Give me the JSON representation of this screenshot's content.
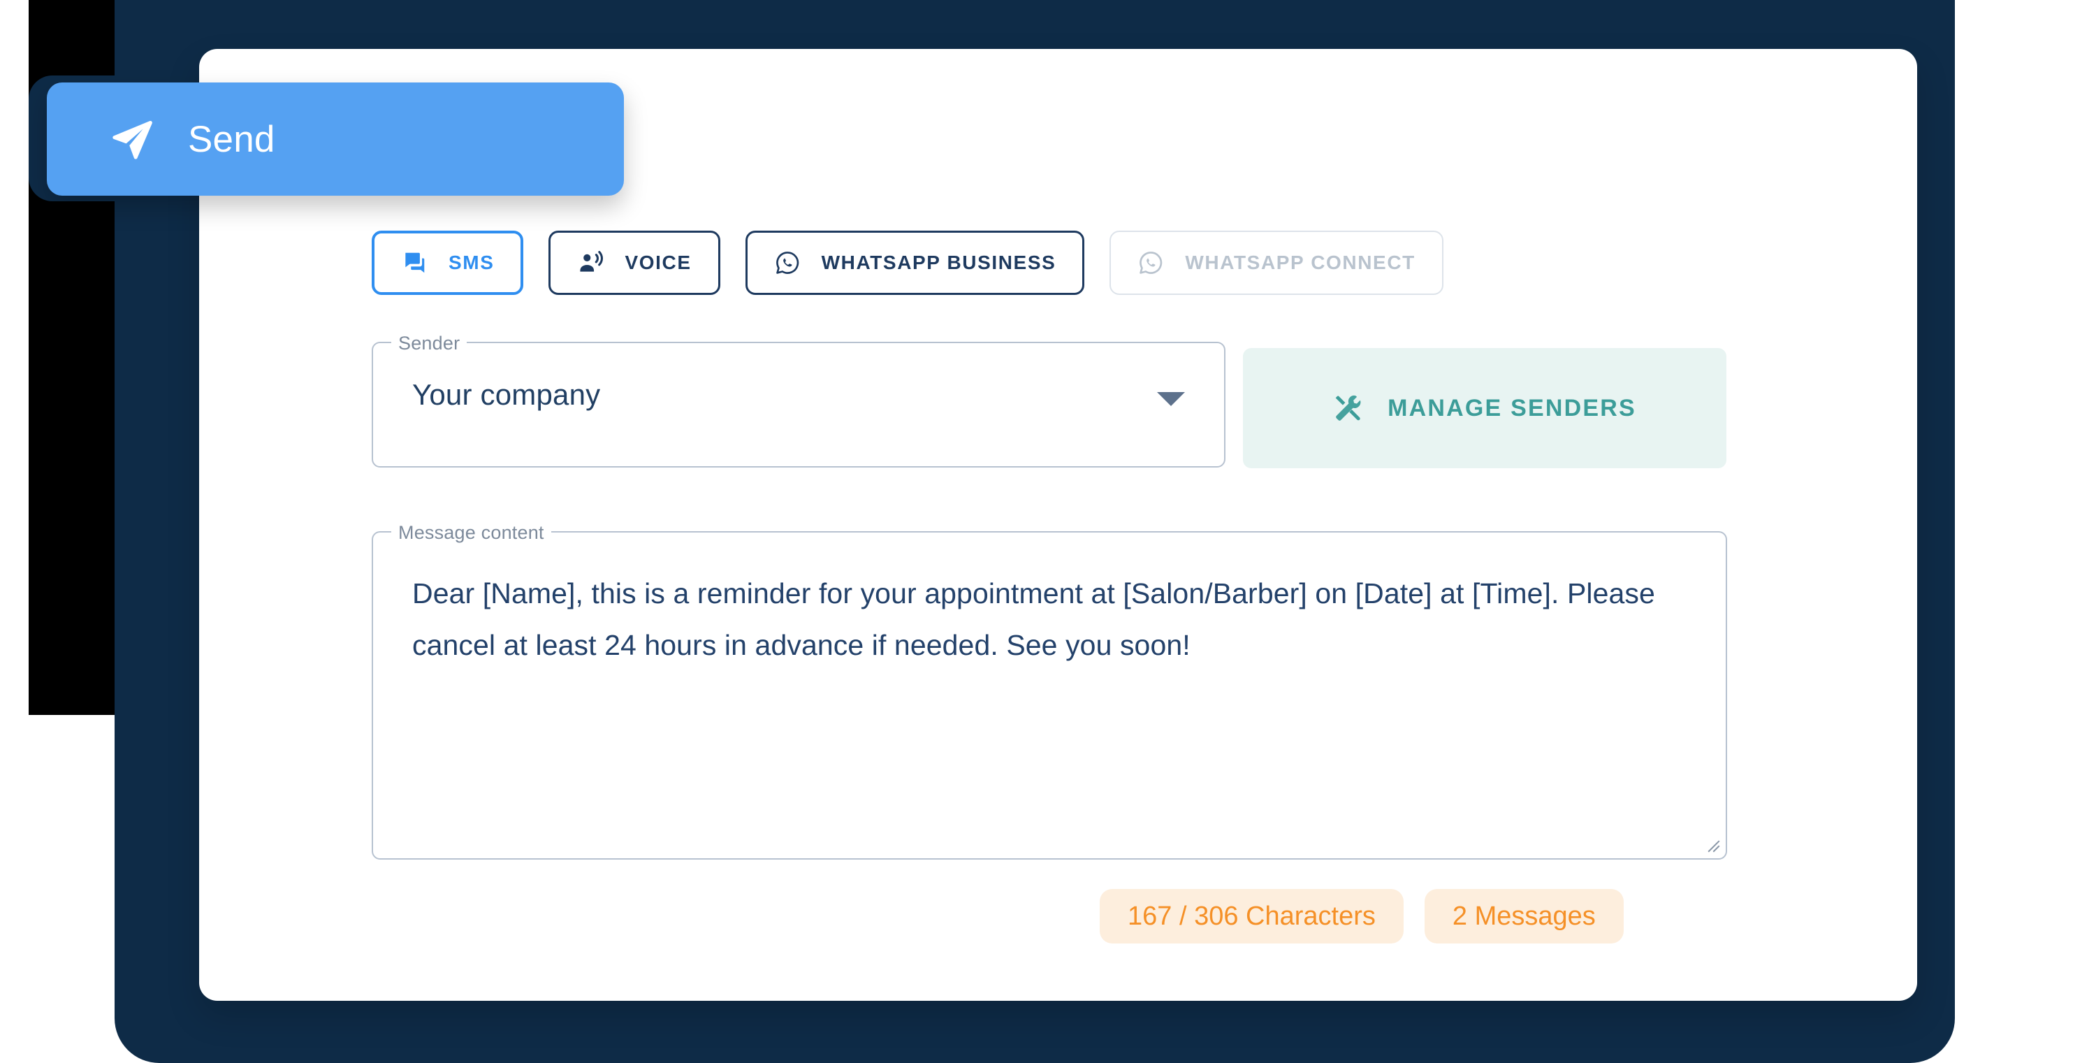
{
  "theme": {
    "page_background": "#ffffff",
    "panel_navy": "#0e2b47",
    "slab_black": "#000000",
    "card_white": "#ffffff",
    "accent_blue": "#2f8ef0",
    "send_blue": "#55a1f2",
    "teal": "#3c9d99",
    "teal_bg": "#e8f4f2",
    "orange_text": "#f59027",
    "orange_bg": "#fdeedd",
    "navy_text": "#1e3a5f",
    "muted_text": "#7d8a9b",
    "disabled_text": "#b9c3ce",
    "field_border": "#b7c2d0"
  },
  "send_button": {
    "label": "Send",
    "icon": "send-icon"
  },
  "channel_tabs": [
    {
      "id": "sms",
      "label": "SMS",
      "icon": "forum-icon",
      "state": "active"
    },
    {
      "id": "voice",
      "label": "VOICE",
      "icon": "record-voice-over-icon",
      "state": "default"
    },
    {
      "id": "whatsapp-business",
      "label": "WHATSAPP BUSINESS",
      "icon": "whatsapp-icon",
      "state": "default"
    },
    {
      "id": "whatsapp-connect",
      "label": "WHATSAPP CONNECT",
      "icon": "whatsapp-icon",
      "state": "disabled"
    }
  ],
  "sender": {
    "legend": "Sender",
    "value": "Your company",
    "caret_icon": "chevron-down-icon"
  },
  "manage_senders": {
    "label": "MANAGE SENDERS",
    "icon": "handyman-tools-icon"
  },
  "message": {
    "legend": "Message content",
    "value": "Dear [Name], this is a reminder for your appointment at [Salon/Barber] on [Date] at [Time]. Please cancel at least 24 hours in advance if needed. See you soon!",
    "resize_handle_icon": "resize-grip-icon"
  },
  "counters": {
    "characters": "167 / 306 Characters",
    "messages": "2 Messages",
    "characters_used": 167,
    "characters_limit": 306,
    "message_count": 2
  }
}
